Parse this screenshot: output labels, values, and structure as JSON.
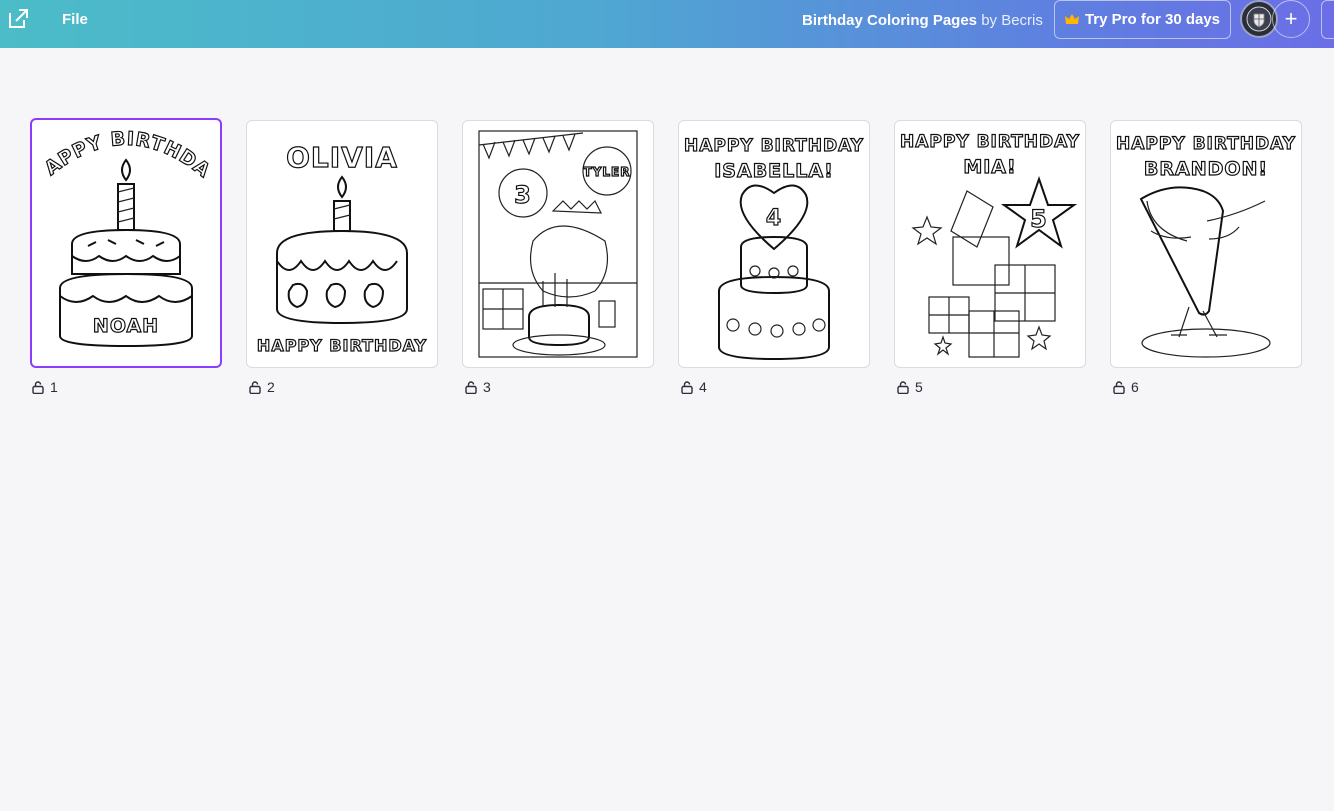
{
  "header": {
    "file_label": "File",
    "title_name": "Birthday Coloring Pages",
    "title_by": "by Becris",
    "try_pro_label": "Try Pro for 30 days",
    "add_label": "+"
  },
  "pages": [
    {
      "number": "1",
      "lines": [
        "HAPPY BIRTHDAY",
        "NOAH"
      ]
    },
    {
      "number": "2",
      "lines": [
        "OLIVIA",
        "HAPPY BIRTHDAY"
      ]
    },
    {
      "number": "3",
      "lines": [
        "3",
        "TYLER"
      ]
    },
    {
      "number": "4",
      "lines": [
        "HAPPY BIRTHDAY",
        "ISABELLA!",
        "4"
      ]
    },
    {
      "number": "5",
      "lines": [
        "HAPPY BIRTHDAY",
        "MIA!",
        "5"
      ]
    },
    {
      "number": "6",
      "lines": [
        "HAPPY BIRTHDAY",
        "BRANDON!"
      ]
    }
  ]
}
